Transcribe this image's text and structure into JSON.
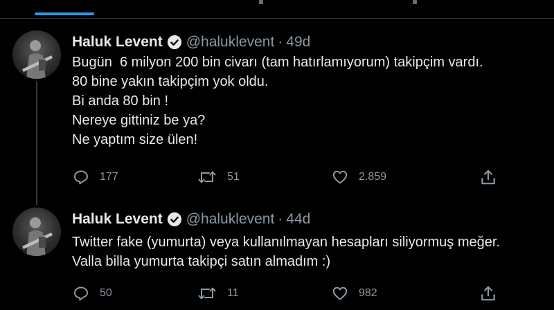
{
  "tweets": [
    {
      "author_name": "Haluk Levent",
      "handle": "@haluklevent",
      "separator": "·",
      "time": "49d",
      "lines": [
        "Bugün  6 milyon 200 bin civarı (tam hatırlamıyorum) takipçim vardı.",
        "80 bine yakın takipçim yok oldu.",
        "Bi anda 80 bin !",
        "Nereye gittiniz be ya?",
        "Ne yaptım size ülen!"
      ],
      "reply_count": "177",
      "retweet_count": "51",
      "like_count": "2.859"
    },
    {
      "author_name": "Haluk Levent",
      "handle": "@haluklevent",
      "separator": "·",
      "time": "44d",
      "lines": [
        "Twitter fake (yumurta) veya kullanılmayan hesapları siliyormuş meğer.",
        "Valla billa yumurta takipçi satın almadım :)"
      ],
      "reply_count": "50",
      "retweet_count": "11",
      "like_count": "982"
    }
  ],
  "icons": {
    "reply": "reply-icon",
    "retweet": "retweet-icon",
    "like": "heart-icon",
    "share": "share-icon",
    "verified": "verified-badge-icon"
  },
  "colors": {
    "background": "#000000",
    "text": "#e7e9ea",
    "secondary_text": "#8b98a5",
    "accent": "#1d9bf0",
    "divider": "#2f3336"
  }
}
